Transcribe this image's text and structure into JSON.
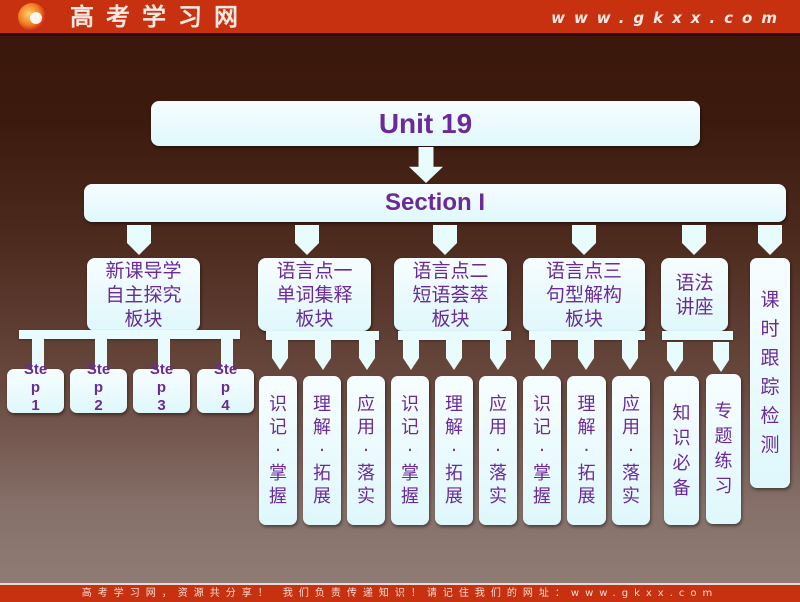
{
  "header": {
    "site_name": "高考学习网",
    "logo_icon": "gkxx-logo-icon",
    "url": "www.gkxx.com"
  },
  "footer": {
    "text": "高考学习网，资源共分享！ 我们负责传递知识！请记住我们的网址：www.gkxx.com"
  },
  "diagram": {
    "title": "Unit 19",
    "section": "Section I",
    "colors": {
      "box_fill": "#e8fbfd",
      "text": "#6a2a99",
      "header_bg": "#c8310f"
    },
    "branches": [
      {
        "lines": [
          "新课导学",
          "自主探究",
          "板块"
        ],
        "children": [
          {
            "lines": [
              "Ste",
              "p",
              "1"
            ]
          },
          {
            "lines": [
              "Ste",
              "p",
              "2"
            ]
          },
          {
            "lines": [
              "Ste",
              "p",
              "3"
            ]
          },
          {
            "lines": [
              "Ste",
              "p",
              "4"
            ]
          }
        ]
      },
      {
        "lines": [
          "语言点一",
          "单词集释",
          "板块"
        ],
        "children": [
          {
            "lines": [
              "识",
              "记",
              "·",
              "掌",
              "握"
            ]
          },
          {
            "lines": [
              "理",
              "解",
              "·",
              "拓",
              "展"
            ]
          },
          {
            "lines": [
              "应",
              "用",
              "·",
              "落",
              "实"
            ]
          }
        ]
      },
      {
        "lines": [
          "语言点二",
          "短语荟萃",
          "板块"
        ],
        "children": [
          {
            "lines": [
              "识",
              "记",
              "·",
              "掌",
              "握"
            ]
          },
          {
            "lines": [
              "理",
              "解",
              "·",
              "拓",
              "展"
            ]
          },
          {
            "lines": [
              "应",
              "用",
              "·",
              "落",
              "实"
            ]
          }
        ]
      },
      {
        "lines": [
          "语言点三",
          "句型解构",
          "板块"
        ],
        "children": [
          {
            "lines": [
              "识",
              "记",
              "·",
              "掌",
              "握"
            ]
          },
          {
            "lines": [
              "理",
              "解",
              "·",
              "拓",
              "展"
            ]
          },
          {
            "lines": [
              "应",
              "用",
              "·",
              "落",
              "实"
            ]
          }
        ]
      },
      {
        "lines": [
          "语法",
          "讲座"
        ],
        "children": [
          {
            "lines": [
              "知",
              "识",
              "必",
              "备"
            ]
          },
          {
            "lines": [
              "专",
              "题",
              "练",
              "习"
            ]
          }
        ]
      },
      {
        "lines": [
          "课",
          "时",
          "跟",
          "踪",
          "检",
          "测"
        ],
        "children": []
      }
    ]
  }
}
